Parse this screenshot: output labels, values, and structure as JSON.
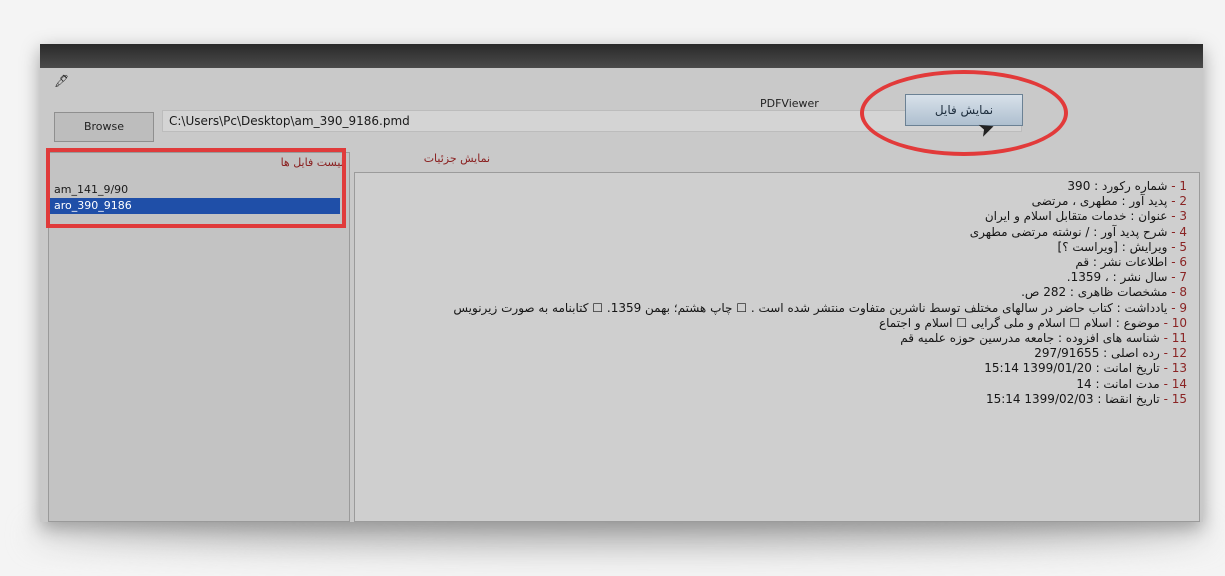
{
  "window": {
    "title": "PDFViewer"
  },
  "toolbar": {
    "browse_label": "Browse",
    "path_value": "C:\\Users\\Pc\\Desktop\\am_390_9186.pmd",
    "show_file_label": "نمایش فایل"
  },
  "left_panel": {
    "header": "لیست فایل ها",
    "items": [
      {
        "label": "am_141_9/90"
      },
      {
        "label": "aro_390_9186",
        "selected": true
      }
    ]
  },
  "right_panel": {
    "tab_label": "نمایش جزئیات",
    "lines": [
      {
        "num": "1",
        "text": "شماره رکورد : 390"
      },
      {
        "num": "2",
        "text": "پدید آور : مطهری ، مرتضی"
      },
      {
        "num": "3",
        "text": "عنوان : خدمات متقابل اسلام و ایران"
      },
      {
        "num": "4",
        "text": "شرح پدید آور : / نوشته مرتضی مطهری"
      },
      {
        "num": "5",
        "text": "ویرایش : [ویراست ؟]"
      },
      {
        "num": "6",
        "text": "اطلاعات نشر : قم"
      },
      {
        "num": "7",
        "text": "سال نشر : ، 1359."
      },
      {
        "num": "8",
        "text": "مشخصات ظاهری : 282 ص."
      },
      {
        "num": "9",
        "text": "یادداشت : کتاب حاضر در سالهای مختلف توسط ناشرین متفاوت منتشر شده است . ☐ چاپ هشتم؛ بهمن 1359. ☐ کتابنامه به صورت زیرنویس"
      },
      {
        "num": "10",
        "text": "موضوع : اسلام ☐ اسلام و ملی گرایی ☐ اسلام و اجتماع"
      },
      {
        "num": "11",
        "text": "شناسه های افزوده : جامعه مدرسین حوزه علمیه قم"
      },
      {
        "num": "12",
        "text": "رده اصلی : 297/91655"
      },
      {
        "num": "13",
        "text": "تاریخ امانت : 1399/01/20 15:14"
      },
      {
        "num": "14",
        "text": "مدت امانت : 14"
      },
      {
        "num": "15",
        "text": "تاریخ انقضا : 1399/02/03 15:14"
      }
    ]
  },
  "colors": {
    "annotation_red": "#e03b3b",
    "selection_blue": "#1f4fa8"
  }
}
